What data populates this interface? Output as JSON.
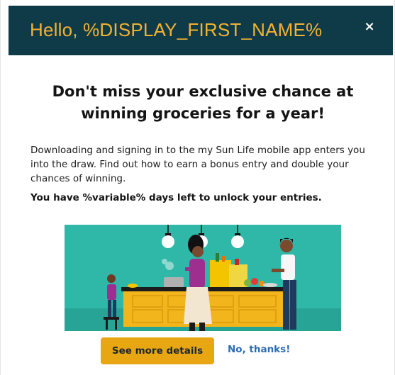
{
  "header": {
    "title": "Hello, %DISPLAY_FIRST_NAME%",
    "close_symbol": "×",
    "close_icon": "close-icon"
  },
  "content": {
    "headline": "Don't miss your exclusive chance at winning groceries for a year!",
    "body": "Downloading and signing in to the my Sun Life mobile app enters you into the draw. Find out how to earn a bonus entry and double your chances of winning.",
    "emphasis": "You have %variable% days left to unlock your entries."
  },
  "illustration": {
    "subject": "family-in-kitchen-illustration"
  },
  "actions": {
    "primary_label": "See more details",
    "secondary_label": "No, thanks!"
  },
  "colors": {
    "header_bg": "#0f3a47",
    "header_text": "#f2b233",
    "button_bg": "#e8a712",
    "link": "#2e6db3",
    "illustration_bg": "#2fb7a8"
  }
}
